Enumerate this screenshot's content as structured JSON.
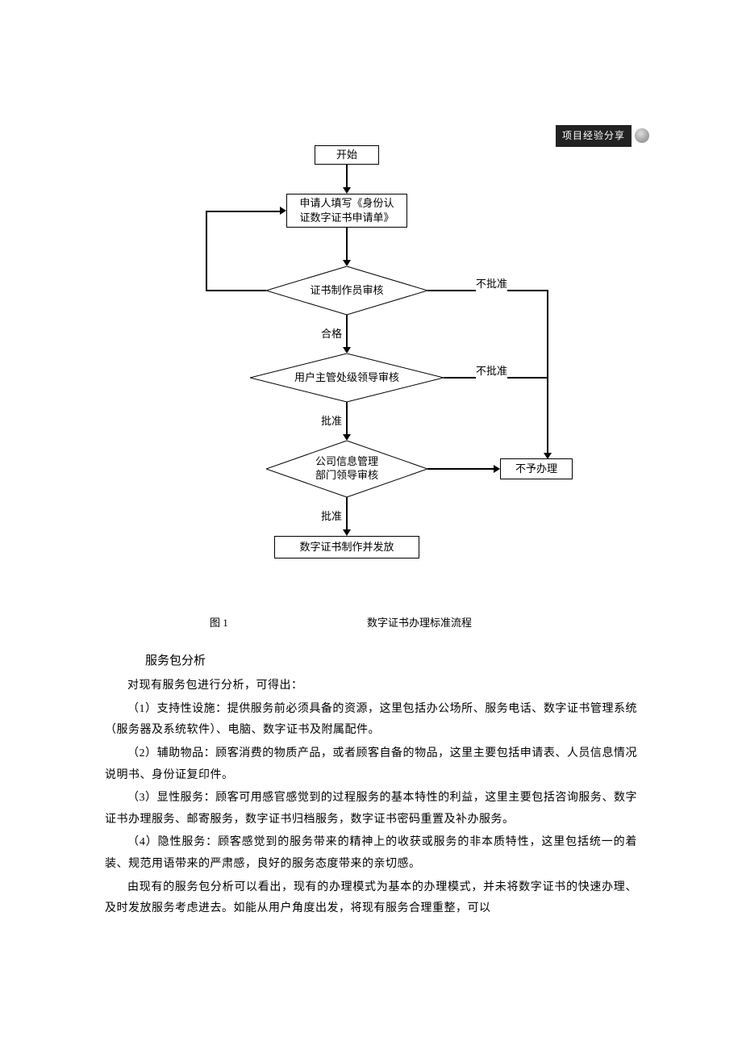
{
  "tag": {
    "label": "项目经验分享"
  },
  "flowchart": {
    "start": "开始",
    "step1": "申请人填写《身份认\n证数字证书申请单》",
    "review1": "证书制作员审核",
    "edge_reject": "不批准",
    "edge_pass1": "合格",
    "review2": "用户主管处级领导审核",
    "edge_pass2": "批准",
    "review3": "公司信息管理\n部门领导审核",
    "edge_pass3": "批准",
    "final": "数字证书制作并发放",
    "reject_box": "不予办理"
  },
  "caption": {
    "fig_no": "图 1",
    "text": "数字证书办理标准流程"
  },
  "section": {
    "title": "服务包分析"
  },
  "paragraphs": {
    "p0": "对现有服务包进行分析，可得出：",
    "p1": "（1）支持性设施：提供服务前必须具备的资源，这里包括办公场所、服务电话、数字证书管理系统（服务器及系统软件）、电脑、数字证书及附属配件。",
    "p2": "（2）辅助物品：顾客消费的物质产品，或者顾客自备的物品，这里主要包括申请表、人员信息情况说明书、身份证复印件。",
    "p3": "（3）显性服务：顾客可用感官感觉到的过程服务的基本特性的利益，这里主要包括咨询服务、数字证书办理服务、邮寄服务，数字证书归档服务，数字证书密码重置及补办服务。",
    "p4": "（4）隐性服务：顾客感觉到的服务带来的精神上的收获或服务的非本质特性，这里包括统一的着装、规范用语带来的严肃感，良好的服务态度带来的亲切感。",
    "p5": "由现有的服务包分析可以看出，现有的办理模式为基本的办理模式，并未将数字证书的快速办理、及时发放服务考虑进去。如能从用户角度出发，将现有服务合理重整，可以"
  }
}
